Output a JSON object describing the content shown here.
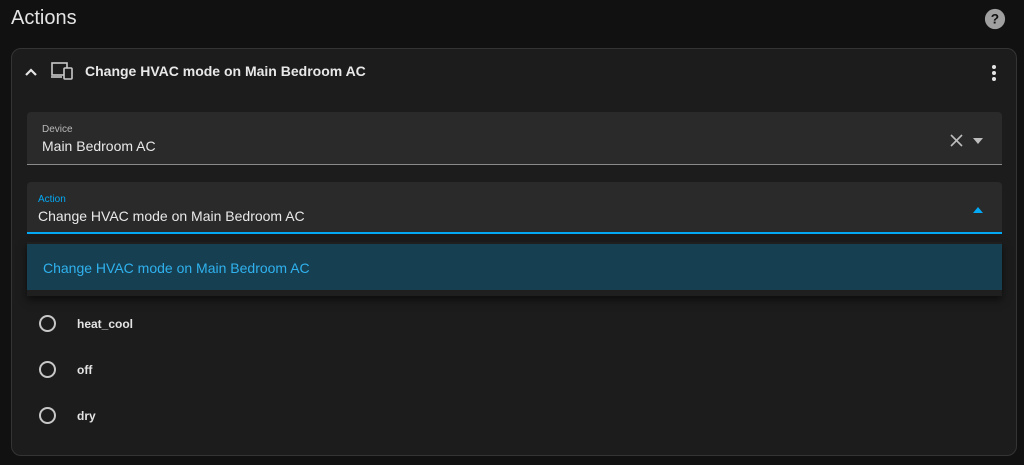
{
  "header": {
    "title": "Actions",
    "help_icon": "help-circle-icon"
  },
  "action_card": {
    "collapse_icon": "chevron-up-icon",
    "device_icon": "devices-icon",
    "title": "Change HVAC mode on Main Bedroom AC",
    "menu_icon": "dots-vertical-icon"
  },
  "device_field": {
    "label": "Device",
    "value": "Main Bedroom AC",
    "clear_icon": "close-icon",
    "caret_icon": "caret-down-icon"
  },
  "action_field": {
    "label": "Action",
    "value": "Change HVAC mode on Main Bedroom AC",
    "caret_icon": "caret-up-icon"
  },
  "dropdown": {
    "options": [
      {
        "label": "Change HVAC mode on Main Bedroom AC",
        "selected": true
      }
    ]
  },
  "hvac_modes": {
    "options": [
      {
        "label": "heat_cool",
        "checked": false
      },
      {
        "label": "off",
        "checked": false
      },
      {
        "label": "dry",
        "checked": false
      }
    ]
  },
  "colors": {
    "background": "#111111",
    "card": "#1c1c1c",
    "field": "#2a2a2a",
    "accent": "#03a9f4",
    "selected_option_bg": "#173f52"
  }
}
